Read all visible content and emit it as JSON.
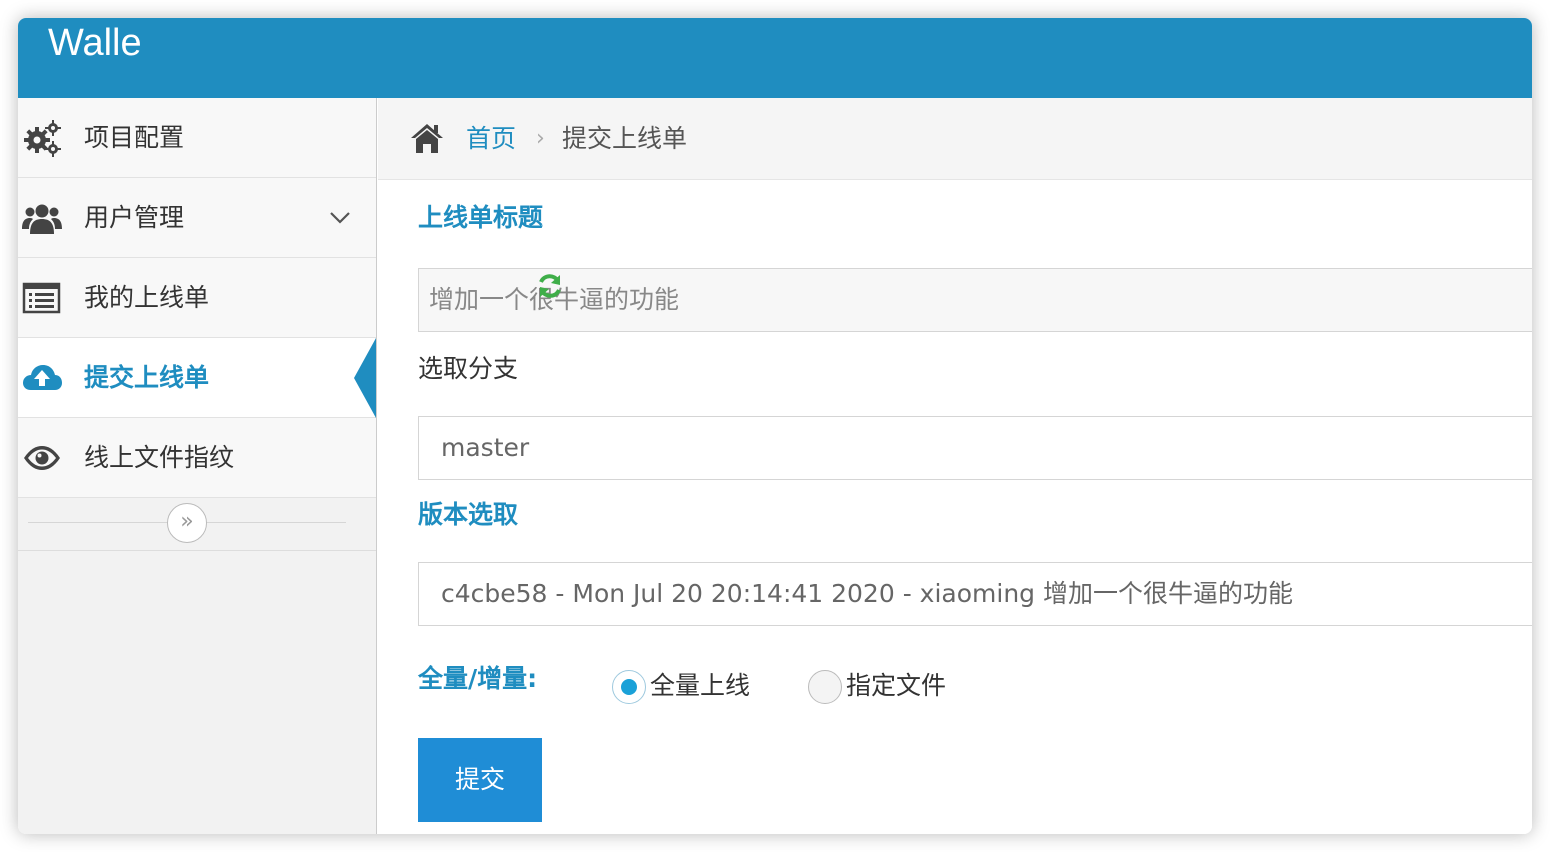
{
  "app": {
    "brand": "Walle"
  },
  "sidebar": {
    "items": [
      {
        "label": "项目配置",
        "icon": "cogs-icon"
      },
      {
        "label": "用户管理",
        "icon": "users-icon",
        "has_submenu": true
      },
      {
        "label": "我的上线单",
        "icon": "list-icon"
      },
      {
        "label": "提交上线单",
        "icon": "cloud-upload-icon",
        "active": true
      },
      {
        "label": "线上文件指纹",
        "icon": "eye-icon"
      }
    ],
    "collapse_glyph": "»"
  },
  "breadcrumb": {
    "home_icon": "home-icon",
    "home": "首页",
    "separator": "›",
    "current": "提交上线单"
  },
  "form": {
    "title_label": "上线单标题",
    "title_value": "增加一个很牛逼的功能",
    "branch_label": "选取分支",
    "branch_refresh_icon": "refresh-icon",
    "branch_value": "master",
    "version_label": "版本选取",
    "version_value": "c4cbe58 - Mon Jul 20 20:14:41 2020 - xiaoming 增加一个很牛逼的功能",
    "mode_label": "全量/增量:",
    "mode_options": [
      {
        "label": "全量上线",
        "checked": true
      },
      {
        "label": "指定文件",
        "checked": false
      }
    ],
    "submit_label": "提交"
  },
  "colors": {
    "brand": "#1f8dc0",
    "button": "#1f8dd6",
    "refresh": "#3fae49"
  }
}
